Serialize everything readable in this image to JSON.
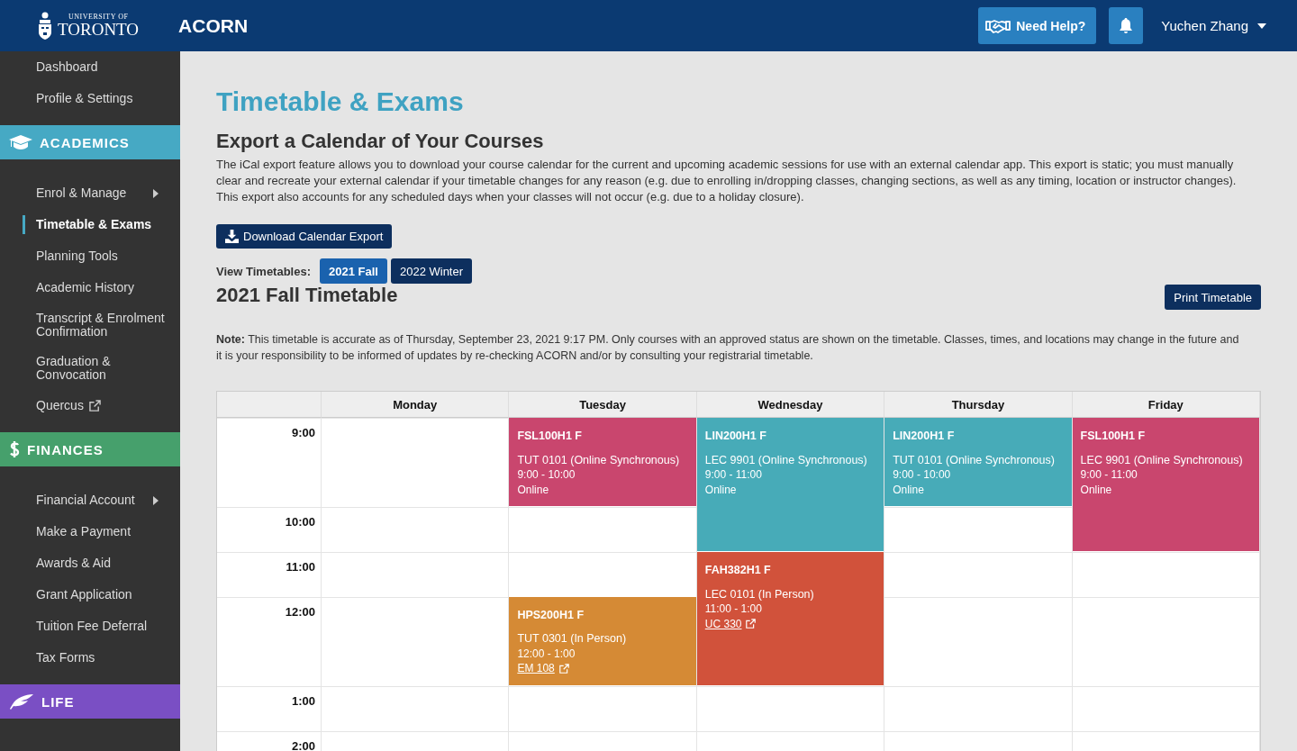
{
  "header": {
    "logo": {
      "line1": "UNIVERSITY OF",
      "line2": "TORONTO"
    },
    "app_name": "ACORN",
    "help_button": "Need Help?",
    "user_name": "Yuchen Zhang"
  },
  "sidebar": [
    {
      "kind": "item",
      "label": "Dashboard",
      "selected": false
    },
    {
      "kind": "item",
      "label": "Profile & Settings",
      "selected": false
    },
    {
      "kind": "section",
      "label": "ACADEMICS",
      "color": "#46a9c4"
    },
    {
      "kind": "submenu",
      "label": "Enrol & Manage",
      "selected": false
    },
    {
      "kind": "item",
      "label": "Timetable & Exams",
      "selected": true
    },
    {
      "kind": "item",
      "label": "Planning Tools",
      "selected": false
    },
    {
      "kind": "item",
      "label": "Academic History",
      "selected": false
    },
    {
      "kind": "item",
      "label": "Transcript & Enrolment Confirmation",
      "selected": false
    },
    {
      "kind": "item",
      "label": "Graduation & Convocation",
      "selected": false
    },
    {
      "kind": "external",
      "label": "Quercus",
      "selected": false
    },
    {
      "kind": "section",
      "label": "FINANCES",
      "color": "#46a06c"
    },
    {
      "kind": "submenu",
      "label": "Financial Account",
      "selected": false
    },
    {
      "kind": "item",
      "label": "Make a Payment",
      "selected": false
    },
    {
      "kind": "item",
      "label": "Awards & Aid",
      "selected": false
    },
    {
      "kind": "item",
      "label": "Grant Application",
      "selected": false
    },
    {
      "kind": "item",
      "label": "Tuition Fee Deferral",
      "selected": false
    },
    {
      "kind": "item",
      "label": "Tax Forms",
      "selected": false
    },
    {
      "kind": "section",
      "label": "LIFE",
      "color": "#7a4fc4"
    }
  ],
  "page_title": "Timetable & Exams",
  "export": {
    "heading": "Export a Calendar of Your Courses",
    "description": "The iCal export feature allows you to download your course calendar for the current and upcoming academic sessions for use with an external calendar app. This export is static; you must manually clear and recreate your external calendar if your timetable changes for any reason (e.g. due to enrolling in/dropping classes, changing sections, as well as any timing, location or instructor changes). This export also accounts for any scheduled days when your classes will not occur (e.g. due to a holiday closure).",
    "button": "Download Calendar Export"
  },
  "view_timetables": {
    "label": "View Timetables:",
    "options": [
      {
        "label": "2021 Fall",
        "selected": true
      },
      {
        "label": "2022 Winter",
        "selected": false
      }
    ]
  },
  "timetable_title": "2021 Fall Timetable",
  "print_button": "Print Timetable",
  "note": "**Note:** This timetable is accurate as of Thursday, September 23, 2021 9:17 PM. Only courses with an approved status are shown on the timetable. Classes, times, and locations may change in the future and it is your responsibility to be informed of updates by re-checking ACORN and/or by consulting your registrarial timetable.",
  "timetable": {
    "times": [
      "9:00",
      "10:00",
      "11:00",
      "12:00",
      "1:00",
      "2:00"
    ],
    "days": [
      {
        "name": "Monday"
      },
      {
        "name": "Tuesday",
        "events": [
          {
            "course": "FSL100H1 F",
            "section": "TUT 0101 (Online Synchronous)",
            "time": "9:00 - 10:00",
            "location": {
              "text": "Online",
              "link": false
            },
            "color": "#c9466e"
          },
          {
            "course": "HPS200H1 F",
            "section": "TUT 0301 (In Person)",
            "time": "12:00 - 1:00",
            "location": {
              "text": "EM 108",
              "link": true
            },
            "color": "#d58a35"
          }
        ]
      },
      {
        "name": "Wednesday",
        "events": [
          {
            "course": "LIN200H1 F",
            "section": "LEC 9901 (Online Synchronous)",
            "time": "9:00 - 11:00",
            "location": {
              "text": "Online",
              "link": false
            },
            "color": "#47abb8"
          },
          {
            "course": "FAH382H1 F",
            "section": "LEC 0101 (In Person)",
            "time": "11:00 - 1:00",
            "location": {
              "text": "UC 330",
              "link": true
            },
            "color": "#d1523b"
          }
        ]
      },
      {
        "name": "Thursday",
        "events": [
          {
            "course": "LIN200H1 F",
            "section": "TUT 0101 (Online Synchronous)",
            "time": "9:00 - 10:00",
            "location": {
              "text": "Online",
              "link": false
            },
            "color": "#47abb8"
          }
        ]
      },
      {
        "name": "Friday",
        "events": [
          {
            "course": "FSL100H1 F",
            "section": "LEC 9901 (Online Synchronous)",
            "time": "9:00 - 11:00",
            "location": {
              "text": "Online",
              "link": false
            },
            "color": "#c9466e"
          }
        ]
      }
    ]
  }
}
